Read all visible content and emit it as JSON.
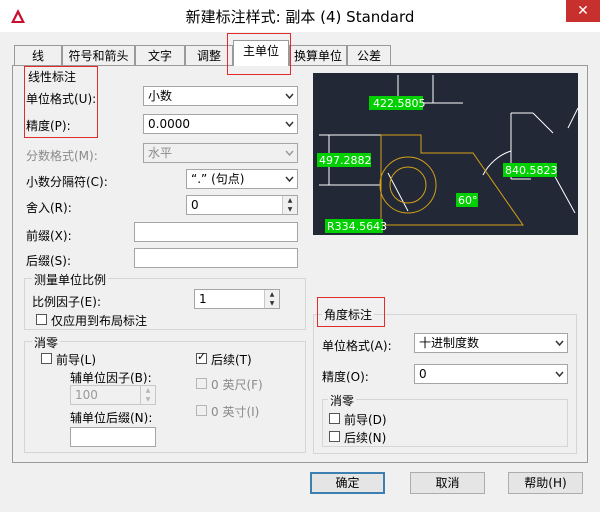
{
  "window": {
    "title": "新建标注样式: 副本 (4) Standard",
    "close_label": "✕"
  },
  "tabs": [
    {
      "label": "线"
    },
    {
      "label": "符号和箭头"
    },
    {
      "label": "文字"
    },
    {
      "label": "调整"
    },
    {
      "label": "主单位"
    },
    {
      "label": "换算单位"
    },
    {
      "label": "公差"
    }
  ],
  "linear": {
    "group_label": "线性标注",
    "unit_format_label": "单位格式(U):",
    "unit_format_value": "小数",
    "precision_label": "精度(P):",
    "precision_value": "0.0000",
    "fraction_format_label": "分数格式(M):",
    "fraction_format_value": "水平",
    "decimal_sep_label": "小数分隔符(C):",
    "decimal_sep_value": "“.” (句点)",
    "round_label": "舍入(R):",
    "round_value": "0",
    "prefix_label": "前缀(X):",
    "prefix_value": "",
    "suffix_label": "后缀(S):",
    "suffix_value": ""
  },
  "scale": {
    "group_label": "测量单位比例",
    "factor_label": "比例因子(E):",
    "factor_value": "1",
    "layout_only_label": "仅应用到布局标注"
  },
  "zero_linear": {
    "group_label": "消零",
    "leading_label": "前导(L)",
    "sub_factor_label": "辅单位因子(B):",
    "sub_factor_value": "100",
    "sub_suffix_label": "辅单位后缀(N):",
    "sub_suffix_value": "",
    "trailing_label": "后续(T)",
    "feet_label": "0 英尺(F)",
    "inches_label": "0 英寸(I)"
  },
  "angular": {
    "group_label": "角度标注",
    "unit_format_label": "单位格式(A):",
    "unit_format_value": "十进制度数",
    "precision_label": "精度(O):",
    "precision_value": "0",
    "zero_group_label": "消零",
    "leading_label": "前导(D)",
    "trailing_label": "后续(N)"
  },
  "preview": {
    "dim_top": "422.5805",
    "dim_left": "497.2882",
    "dim_right": "840.5823",
    "dim_angle": "60°",
    "dim_radius": "R334.5643"
  },
  "buttons": {
    "ok": "确定",
    "cancel": "取消",
    "help": "帮助(H)"
  },
  "colors": {
    "annotation_red": "#e22b2b",
    "preview_bg": "#222836",
    "dim_text_bg": "#00d000",
    "geometry": "#d4a017"
  }
}
